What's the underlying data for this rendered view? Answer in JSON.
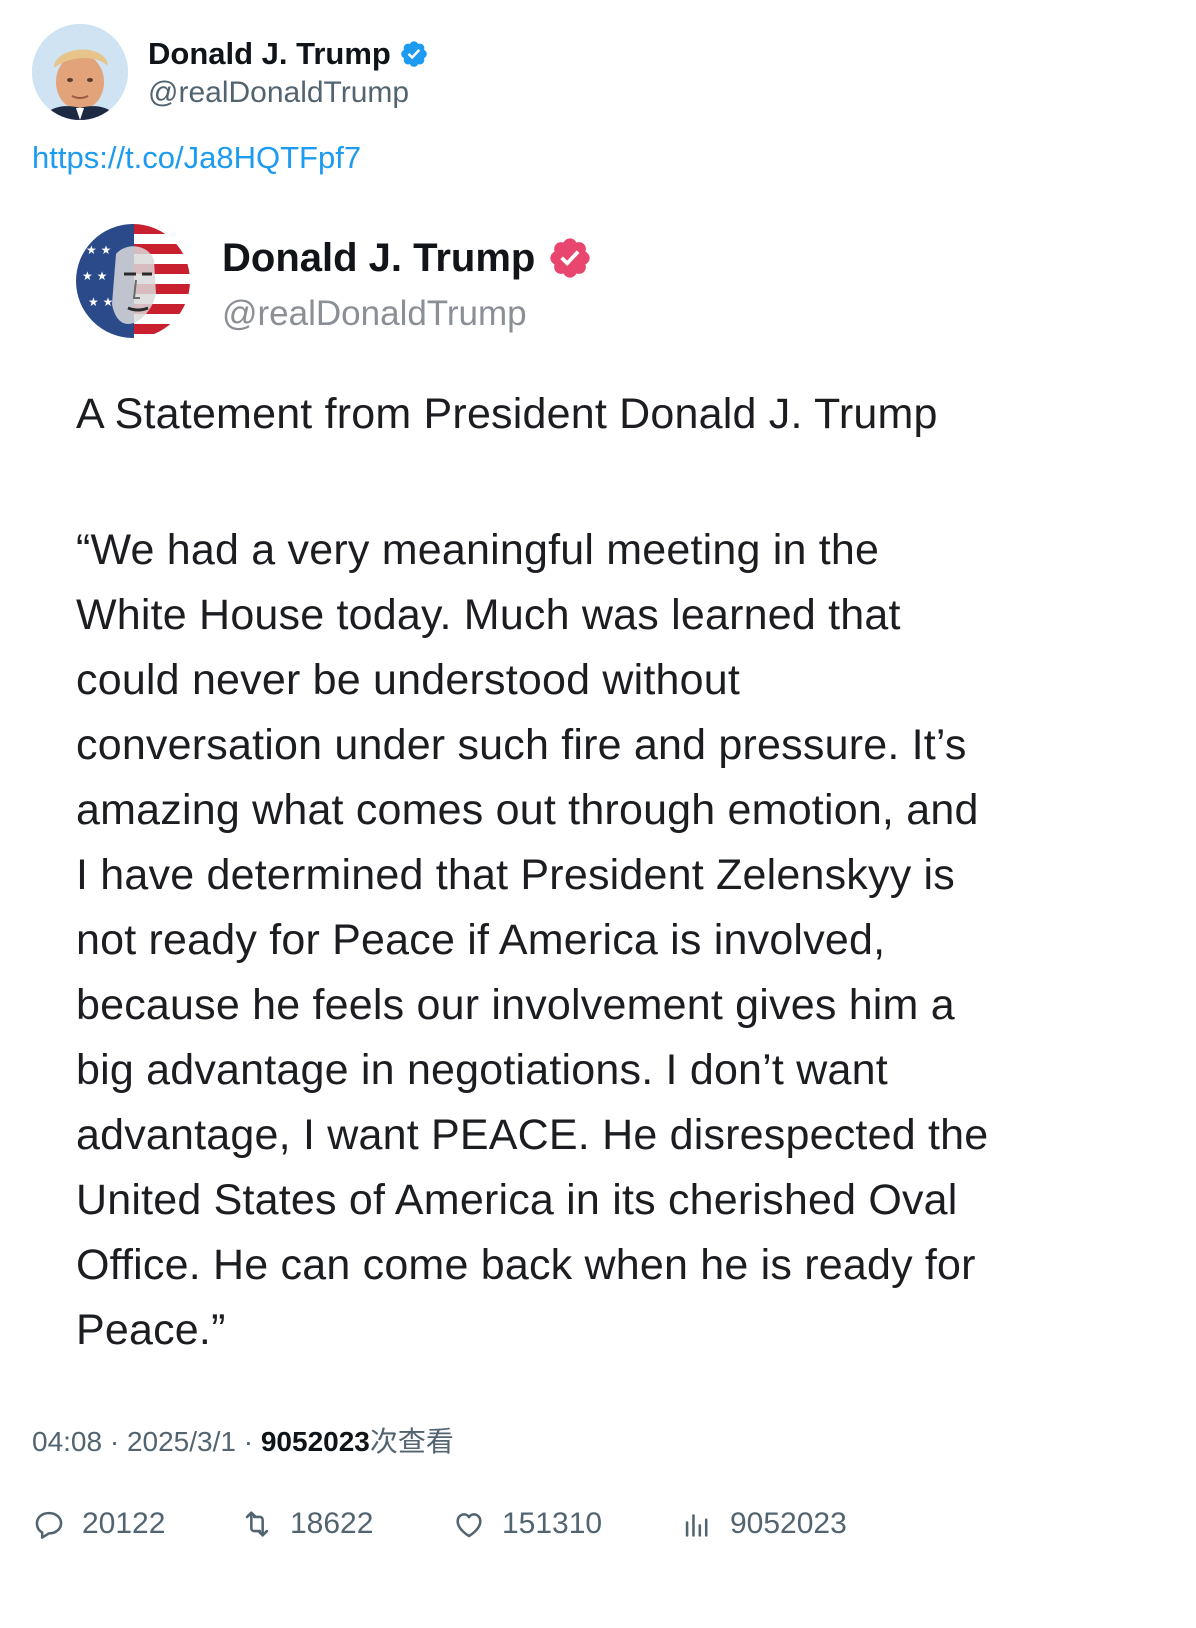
{
  "tweet": {
    "author": {
      "display_name": "Donald J. Trump",
      "handle": "@realDonaldTrump",
      "verified": true
    },
    "link_text": "https://t.co/Ja8HQTFpf7",
    "embedded_post": {
      "display_name": "Donald J. Trump",
      "handle": "@realDonaldTrump",
      "title": "A Statement from President Donald J. Trump",
      "body_lines": [
        "“We had a very meaningful meeting in the",
        "White House today. Much was learned that",
        "could never be understood without",
        "conversation under such fire and pressure. It’s",
        "amazing what comes out through emotion, and",
        "I have determined that President Zelenskyy is",
        "not ready for Peace if America is involved,",
        "because he feels our involvement gives him a",
        "big advantage in negotiations. I don’t want",
        "advantage, I want PEACE. He disrespected the",
        "United States of America in its cherished Oval",
        "Office. He can come back when he is ready for",
        "Peace.”"
      ]
    },
    "meta": {
      "time": "04:08",
      "separator": " · ",
      "date": "2025/3/1",
      "views_count": "9052023",
      "views_label": "次查看"
    },
    "actions": {
      "replies": "20122",
      "retweets": "18622",
      "likes": "151310",
      "views": "9052023"
    }
  },
  "colors": {
    "link": "#1d9bf0",
    "verified_blue": "#1d9bf0",
    "verified_pink": "#e8456f",
    "secondary_text": "#536471"
  },
  "icons": {
    "reply": "reply-bubble-icon",
    "retweet": "retweet-icon",
    "like": "heart-icon",
    "views": "bar-chart-icon"
  }
}
